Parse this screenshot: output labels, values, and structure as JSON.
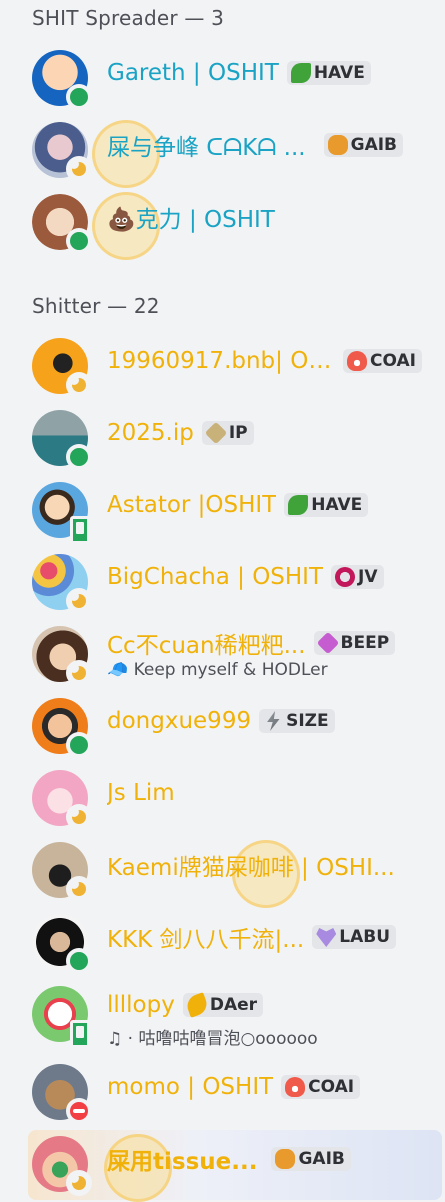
{
  "sections": {
    "spreader": "SHIT Spreader — 3",
    "shitter": "Shitter — 22"
  },
  "members": [
    {
      "name": "Gareth | OSHIT",
      "tag": "HAVE",
      "tag_icon": "leaf-icon",
      "sub": ""
    },
    {
      "name": "屎与争峰 ᑕᗩKᗩ ...",
      "tag": "GAIB",
      "tag_icon": "frog-icon",
      "sub": ""
    },
    {
      "name": "💩克力 | OSHIT",
      "tag": "",
      "tag_icon": "",
      "sub": ""
    },
    {
      "name": "19960917.bnb| OS...",
      "tag": "COAI",
      "tag_icon": "flame-icon",
      "sub": ""
    },
    {
      "name": "2025.ip",
      "tag": "IP",
      "tag_icon": "diamond-icon",
      "sub": ""
    },
    {
      "name": "Astator |OSHIT",
      "tag": "HAVE",
      "tag_icon": "leaf-icon",
      "sub": ""
    },
    {
      "name": "BigChacha | OSHIT",
      "tag": "JV",
      "tag_icon": "ring-icon",
      "sub": ""
    },
    {
      "name": "Cc不cuan稀粑粑...",
      "tag": "BEEP",
      "tag_icon": "diamond-icon",
      "sub": "🧢 Keep myself & HODLer"
    },
    {
      "name": "dongxue999",
      "tag": "SIZE",
      "tag_icon": "bolt-icon",
      "sub": ""
    },
    {
      "name": "Js Lim",
      "tag": "",
      "tag_icon": "",
      "sub": ""
    },
    {
      "name": "Kaemi牌猫屎咖啡 | OSHI...",
      "tag": "",
      "tag_icon": "",
      "sub": ""
    },
    {
      "name": "KKK 剑八八千流|...",
      "tag": "LABU",
      "tag_icon": "heart-icon",
      "sub": ""
    },
    {
      "name": "llllopy",
      "tag": "DAer",
      "tag_icon": "feather-icon",
      "sub": "♫ · 咕噜咕噜冒泡○oooooo"
    },
    {
      "name": "momo | OSHIT",
      "tag": "COAI",
      "tag_icon": "flame-icon",
      "sub": ""
    },
    {
      "name": "屎用tissue...",
      "tag": "GAIB",
      "tag_icon": "frog-icon",
      "sub": ""
    }
  ],
  "colors": {
    "spreader_name": "#1aa3c4",
    "shitter_name": "#f0b20a",
    "online": "#23a55a",
    "idle": "#f0b232",
    "dnd": "#f23f43"
  }
}
